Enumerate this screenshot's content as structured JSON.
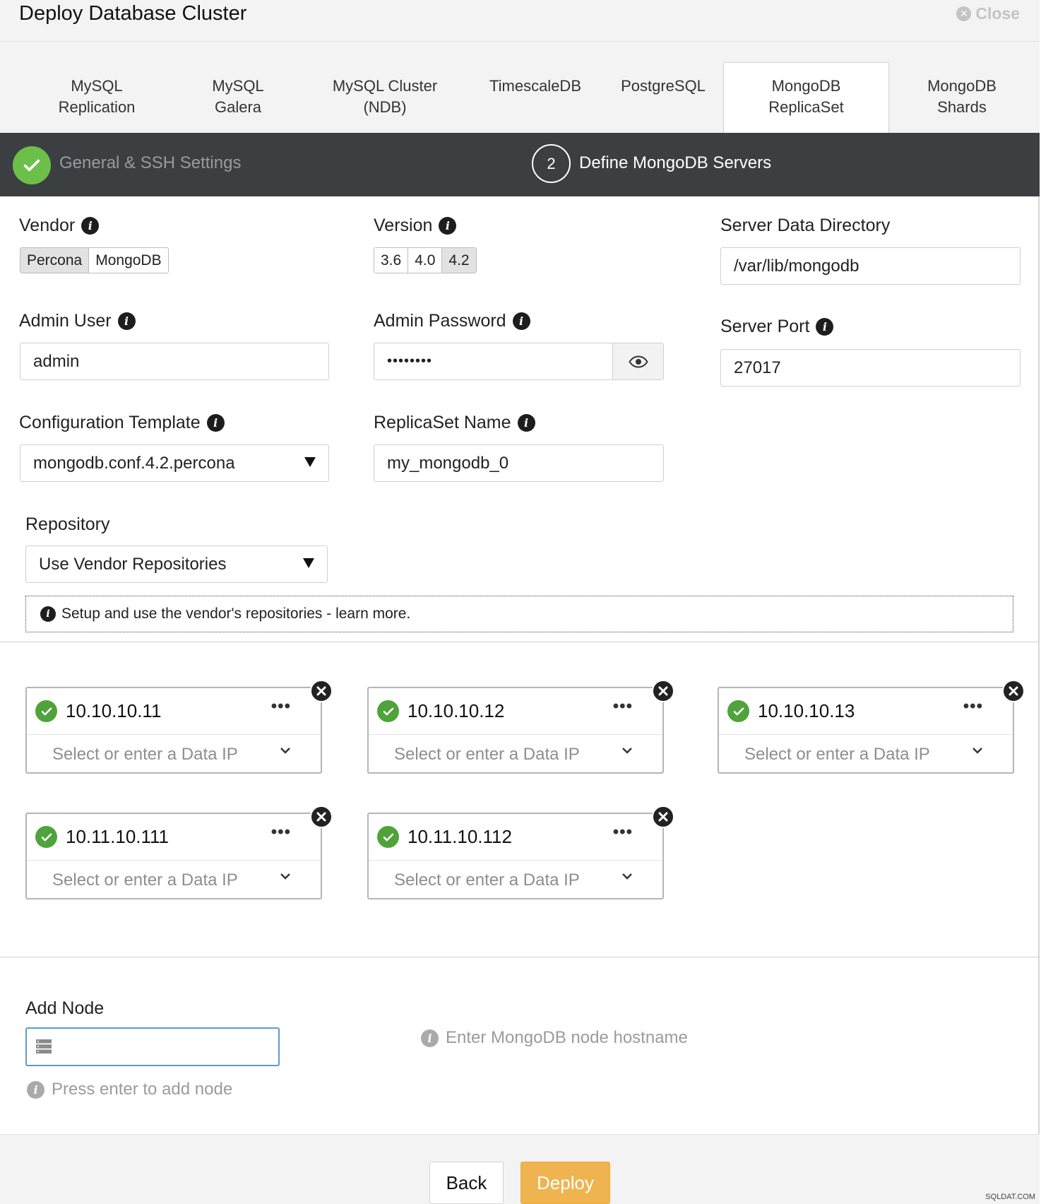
{
  "dialog": {
    "title": "Deploy Database Cluster",
    "close_label": "Close"
  },
  "db_tabs": [
    {
      "line1": "MySQL",
      "line2": "Replication"
    },
    {
      "line1": "MySQL",
      "line2": "Galera"
    },
    {
      "line1": "MySQL Cluster",
      "line2": "(NDB)"
    },
    {
      "line1": "TimescaleDB",
      "line2": ""
    },
    {
      "line1": "PostgreSQL",
      "line2": ""
    },
    {
      "line1": "MongoDB",
      "line2": "ReplicaSet"
    },
    {
      "line1": "MongoDB",
      "line2": "Shards"
    }
  ],
  "active_tab": "MongoDB ReplicaSet",
  "steps": [
    {
      "label": "General & SSH Settings",
      "status": "done"
    },
    {
      "number": "2",
      "label": "Define MongoDB Servers",
      "status": "current"
    }
  ],
  "form": {
    "vendor": {
      "label": "Vendor",
      "options": [
        "Percona",
        "MongoDB"
      ],
      "selected": "Percona"
    },
    "version": {
      "label": "Version",
      "options": [
        "3.6",
        "4.0",
        "4.2"
      ],
      "selected": "4.2"
    },
    "data_dir": {
      "label": "Server Data Directory",
      "value": "/var/lib/mongodb"
    },
    "admin_user": {
      "label": "Admin User",
      "value": "admin"
    },
    "admin_password": {
      "label": "Admin Password",
      "value": "••••••••"
    },
    "server_port": {
      "label": "Server Port",
      "value": "27017"
    },
    "config_template": {
      "label": "Configuration Template",
      "value": "mongodb.conf.4.2.percona"
    },
    "replicaset_name": {
      "label": "ReplicaSet Name",
      "value": "my_mongodb_0"
    },
    "repository": {
      "label": "Repository",
      "value": "Use Vendor Repositories"
    },
    "repo_note": "Setup and use the vendor's repositories - learn more."
  },
  "nodes": [
    {
      "ip": "10.10.10.11",
      "data_ip_placeholder": "Select or enter a Data IP"
    },
    {
      "ip": "10.10.10.12",
      "data_ip_placeholder": "Select or enter a Data IP"
    },
    {
      "ip": "10.10.10.13",
      "data_ip_placeholder": "Select or enter a Data IP"
    },
    {
      "ip": "10.11.10.111",
      "data_ip_placeholder": "Select or enter a Data IP"
    },
    {
      "ip": "10.11.10.112",
      "data_ip_placeholder": "Select or enter a Data IP"
    }
  ],
  "add_node": {
    "label": "Add Node",
    "value": "",
    "hint": "Enter MongoDB node hostname",
    "help": "Press enter to add node"
  },
  "footer": {
    "back_label": "Back",
    "deploy_label": "Deploy"
  },
  "watermark": "SQLDAT.COM",
  "colors": {
    "accent_green": "#6cc04a",
    "node_ok": "#4fa33a",
    "steps_bar": "#3b3f42",
    "deploy": "#efb44f",
    "focus": "#5b9bd5"
  }
}
